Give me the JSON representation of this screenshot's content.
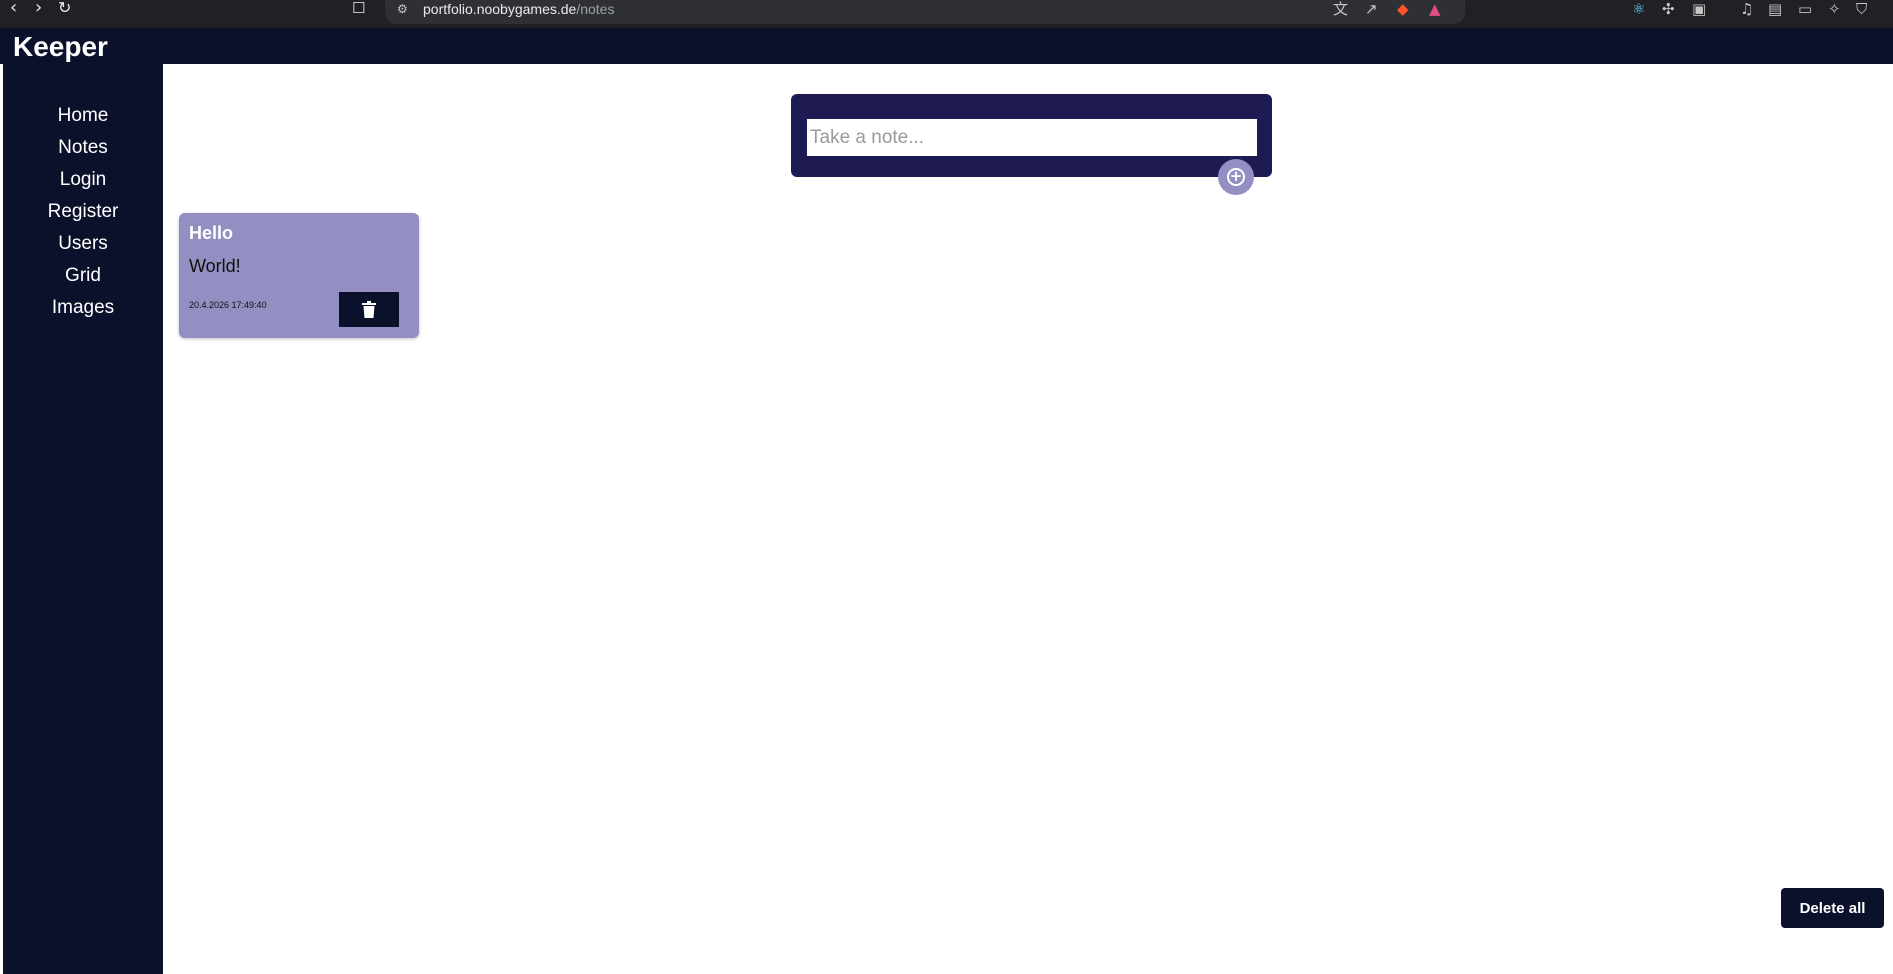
{
  "browser": {
    "url_host": "portfolio.noobygames.de",
    "url_path": "/notes"
  },
  "app": {
    "title": "Keeper"
  },
  "sidebar": {
    "items": [
      {
        "label": "Home"
      },
      {
        "label": "Notes"
      },
      {
        "label": "Login"
      },
      {
        "label": "Register"
      },
      {
        "label": "Users"
      },
      {
        "label": "Grid"
      },
      {
        "label": "Images"
      }
    ]
  },
  "create_note": {
    "placeholder": "Take a note...",
    "value": "",
    "add_icon": "plus-circle-icon"
  },
  "notes": [
    {
      "title": "Hello",
      "content": "World!",
      "timestamp": "20.4.2026 17:49:40",
      "delete_icon": "trash-icon"
    }
  ],
  "actions": {
    "delete_all_label": "Delete all"
  },
  "colors": {
    "navy": "#0b112b",
    "form_bg": "#1e1a52",
    "note_bg": "#938fc2"
  }
}
